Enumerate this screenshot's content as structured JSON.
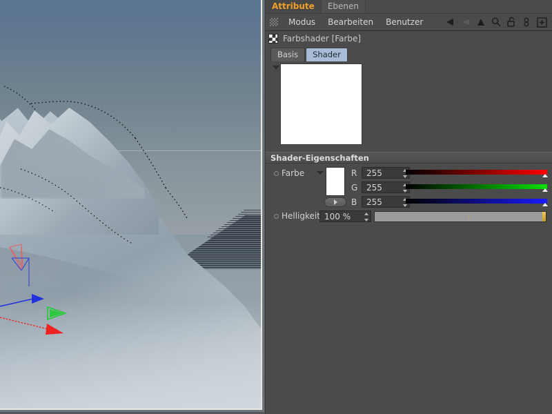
{
  "panel": {
    "tabs": [
      {
        "label": "Attribute",
        "active": true
      },
      {
        "label": "Ebenen",
        "active": false
      }
    ],
    "menu": {
      "grip_icon": "grip-dots-icon",
      "items": [
        "Modus",
        "Bearbeiten",
        "Benutzer"
      ],
      "icons": [
        "back-arrow-icon",
        "forward-arrow-ghost-icon",
        "up-arrow-icon",
        "search-icon",
        "unlocked-padlock-icon",
        "chain-link-icon",
        "plus-box-icon"
      ]
    },
    "object": {
      "icon": "checkerboard-icon",
      "title": "Farbshader [Farbe]"
    },
    "subtabs": [
      {
        "label": "Basis",
        "active": false
      },
      {
        "label": "Shader",
        "active": true
      }
    ],
    "preview": {
      "collapse_icon": "triangle-down-icon",
      "color": "#ffffff"
    },
    "section": {
      "title": "Shader-Eigenschaften"
    },
    "color_property": {
      "label": "Farbe",
      "caret_icon": "triangle-down-icon",
      "swatch_color": "#ffffff",
      "picker_button_icon": "triangle-right-icon",
      "channels": [
        {
          "letter": "R",
          "value": "255",
          "track": "#ff0000"
        },
        {
          "letter": "G",
          "value": "255",
          "track": "#00e000"
        },
        {
          "letter": "B",
          "value": "255",
          "track": "#1a1aff"
        }
      ]
    },
    "brightness_property": {
      "label": "Helligkeit",
      "value": "100 %",
      "slider_percent": 100,
      "handle_color": "#d9a92c"
    }
  },
  "viewport": {
    "name": "perspective-viewport",
    "scene": "landscape-terrain",
    "sky_top_color": "#5a7492",
    "sky_bottom_color": "#96a0a6",
    "terrain_color": "#b8c2cb",
    "gizmo": {
      "x_axis_color": "#ee2222",
      "y_axis_color": "#22cc33",
      "z_axis_color": "#2233dd"
    }
  }
}
